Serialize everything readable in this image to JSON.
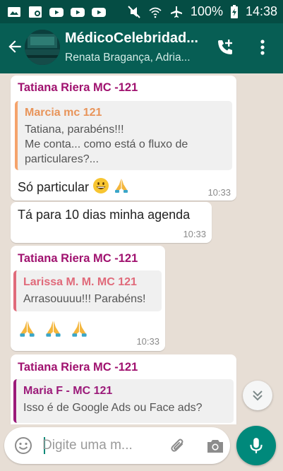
{
  "status_bar": {
    "battery_percent": "100%",
    "time": "14:38",
    "left_icons": [
      "photo-icon",
      "gallery-icon",
      "youtube-icon",
      "youtube-icon",
      "youtube-icon"
    ],
    "right_icons": [
      "mute-icon",
      "wifi-off-icon",
      "airplane-icon",
      "battery-charging-icon"
    ]
  },
  "header": {
    "title": "MédicoCelebridad...",
    "subtitle": "Renata Bragança,  Adria..."
  },
  "messages": [
    {
      "sender": "Tatiana Riera MC -121",
      "quote_name": "Marcia mc 121",
      "quote_name_color": "#e8945a",
      "quote_text_1": "Tatiana, parabéns!!!",
      "quote_text_2": "Me conta... como está o fluxo de",
      "quote_text_3": "particulares?...",
      "text": "Só particular",
      "time": "10:33"
    },
    {
      "text": "Tá para 10 dias minha agenda",
      "time": "10:33"
    },
    {
      "sender": "Tatiana Riera MC -121",
      "quote_name": "Larissa M. M. MC 121",
      "quote_name_color": "#e06a7a",
      "quote_text_1": "Arrasouuuu!!! Parabéns!",
      "time": "10:33"
    },
    {
      "sender": "Tatiana Riera MC -121",
      "quote_name": "Maria F - MC 121",
      "quote_name_color": "#9b1a79",
      "quote_text_1": "Isso é de Google Ads ou Face ads?"
    }
  ],
  "input": {
    "placeholder": "Digite uma m..."
  },
  "colors": {
    "header": "#075e54",
    "status_bar": "#054d44",
    "accent": "#00897b",
    "sender": "#a0126f"
  }
}
